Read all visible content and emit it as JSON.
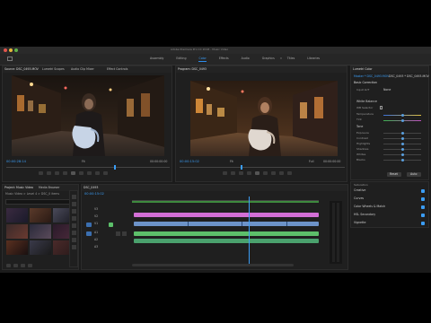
{
  "app": {
    "title": "Adobe Premiere Pro CC 2018 - Music Video",
    "accent": "#2d8ceb",
    "workspaces": [
      "Assembly",
      "Editing",
      "Color",
      "Effects",
      "Audio",
      "Graphics",
      "Titles",
      "Libraries"
    ],
    "active_workspace": "Color"
  },
  "source_monitor": {
    "tabs": [
      "Source: DSC_0493.MOV",
      "Lumetri Scopes",
      "Audio Clip Mixer",
      "Effect Controls"
    ],
    "timecode": "00:00:28:14",
    "duration": "00:00:00:00",
    "zoom": "Fit",
    "icon_names": [
      "marker-icon",
      "in-point-icon",
      "out-point-icon",
      "step-back-icon",
      "play-icon",
      "step-forward-icon",
      "insert-icon",
      "overwrite-icon",
      "export-frame-icon"
    ]
  },
  "program_monitor": {
    "tabs": [
      "Program: DSC_0493"
    ],
    "timecode": "00:00:15:02",
    "duration": "00:00:00:00",
    "zoom": "Fit",
    "quality": "Full"
  },
  "project": {
    "tabs": [
      "Project: Music Video",
      "Media Browser",
      "Libraries"
    ],
    "path": "Music Video > Level 4 > DSC_0 items",
    "thumbnails": [
      "DSC_0481",
      "DSC_0482",
      "DSC_0483",
      "DSC_0484",
      "DSC_0485",
      "DSC_0486"
    ]
  },
  "timeline": {
    "tab": "DSC_0493",
    "timecode": "00:00:15:02",
    "tracks": [
      "V3",
      "V2",
      "V1",
      "A1",
      "A2",
      "A3"
    ],
    "clip_colors": {
      "video_title": "#d36fd6",
      "video_main": "#6d93c9",
      "audio": "#4aa16d",
      "audio_alt": "#5dbf6a"
    }
  },
  "lumetri": {
    "tabs": [
      "Lumetri Color"
    ],
    "source": "Master * DSC_0493.MOV",
    "target": "DSC_0493 * DSC_0493.MOV",
    "sections": [
      "Basic Correction",
      "Creative",
      "Curves",
      "Color Wheels & Match",
      "HSL Secondary",
      "Vignette"
    ],
    "input_lut": "None",
    "white_balance": "White Balance",
    "wb_label": "WB Selector",
    "temperature_label": "Temperature",
    "tint_label": "Tint",
    "tone_label": "Tone",
    "tone_sliders": [
      "Exposure",
      "Contrast",
      "Highlights",
      "Shadows",
      "Whites",
      "Blacks"
    ],
    "saturation_label": "Saturation",
    "buttons": [
      "Reset",
      "Auto"
    ]
  }
}
